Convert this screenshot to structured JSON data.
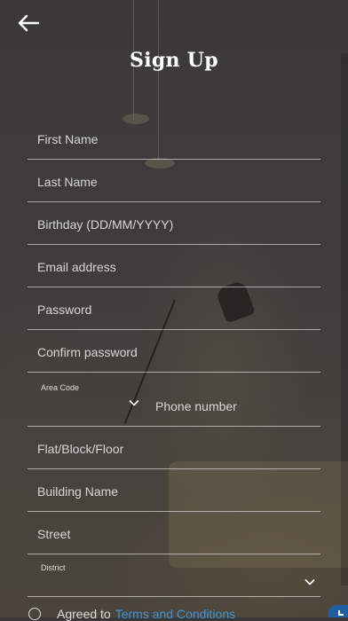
{
  "header": {
    "title": "Sign Up",
    "back_icon": "arrow-left-icon"
  },
  "form": {
    "first_name_placeholder": "First Name",
    "last_name_placeholder": "Last Name",
    "birthday_placeholder": "Birthday (DD/MM/YYYY)",
    "email_placeholder": "Email address",
    "password_placeholder": "Password",
    "confirm_password_placeholder": "Confirm password",
    "area_code_label": "Area Code",
    "phone_placeholder": "Phone number",
    "flat_placeholder": "Flat/Block/Floor",
    "building_placeholder": "Building Name",
    "street_placeholder": "Street",
    "district_label": "District"
  },
  "terms": {
    "prefix": "Agreed to",
    "link": "Terms and Conditions"
  },
  "colors": {
    "link": "#3f95d8",
    "text": "#ffffff",
    "divider": "rgba(255,255,255,0.55)"
  }
}
